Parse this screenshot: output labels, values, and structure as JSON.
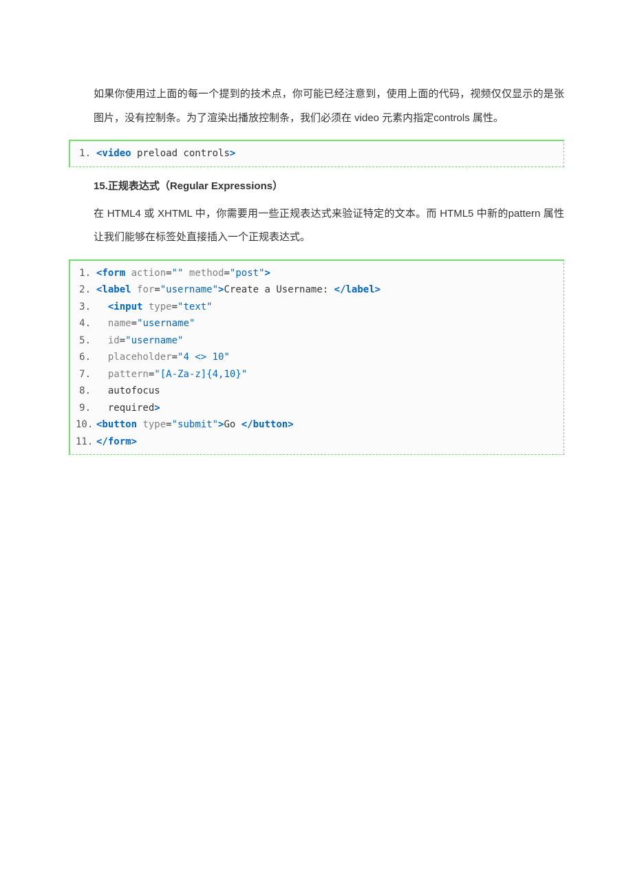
{
  "para1": "如果你使用过上面的每一个提到的技术点，你可能已经注意到，使用上面的代码，视频仅仅显示的是张图片，没有控制条。为了渲染出播放控制条，我们必须在 video 元素内指定controls 属性。",
  "code1": {
    "lines": [
      {
        "no": "1.",
        "html": "<span class='tagb'>&lt;video</span><span class='plain'> preload controls</span><span class='tagb'>&gt;</span>"
      }
    ]
  },
  "heading": "15.正规表达式（Regular Expressions）",
  "para2": "在 HTML4 或 XHTML 中，你需要用一些正规表达式来验证特定的文本。而 HTML5 中新的pattern 属性让我们能够在标签处直接插入一个正规表达式。",
  "code2": {
    "lines": [
      {
        "no": "1.",
        "html": "<span class='tagb'>&lt;form</span> <span class='attr'>action</span><span class='plain'>=</span><span class='val'>\"\"</span> <span class='attr'>method</span><span class='plain'>=</span><span class='val'>\"post\"</span><span class='tagb'>&gt;</span>"
      },
      {
        "no": "2.",
        "html": "<span class='tagb'>&lt;label</span> <span class='attr'>for</span><span class='plain'>=</span><span class='val'>\"username\"</span><span class='tagb'>&gt;</span><span class='txt'>Create a Username: </span><span class='tagb'>&lt;/label&gt;</span>"
      },
      {
        "no": "3.",
        "html": "  <span class='tagb'>&lt;input</span> <span class='attr'>type</span><span class='plain'>=</span><span class='val'>\"text\"</span>"
      },
      {
        "no": "4.",
        "html": "  <span class='attr'>name</span><span class='plain'>=</span><span class='val'>\"username\"</span>"
      },
      {
        "no": "5.",
        "html": "  <span class='attr'>id</span><span class='plain'>=</span><span class='val'>\"username\"</span>"
      },
      {
        "no": "6.",
        "html": "  <span class='attr'>placeholder</span><span class='plain'>=</span><span class='val'>\"4 &lt;&gt; 10\"</span>"
      },
      {
        "no": "7.",
        "html": "  <span class='attr'>pattern</span><span class='plain'>=</span><span class='val'>\"[A-Za-z]{4,10}\"</span>"
      },
      {
        "no": "8.",
        "html": "  <span class='plain'>autofocus</span>"
      },
      {
        "no": "9.",
        "html": "  <span class='plain'>required</span><span class='tagb'>&gt;</span>"
      },
      {
        "no": "10.",
        "html": "<span class='tagb'>&lt;button</span> <span class='attr'>type</span><span class='plain'>=</span><span class='val'>\"submit\"</span><span class='tagb'>&gt;</span><span class='txt'>Go </span><span class='tagb'>&lt;/button&gt;</span>"
      },
      {
        "no": "11.",
        "html": "<span class='tagb'>&lt;/form&gt;</span>"
      }
    ]
  }
}
